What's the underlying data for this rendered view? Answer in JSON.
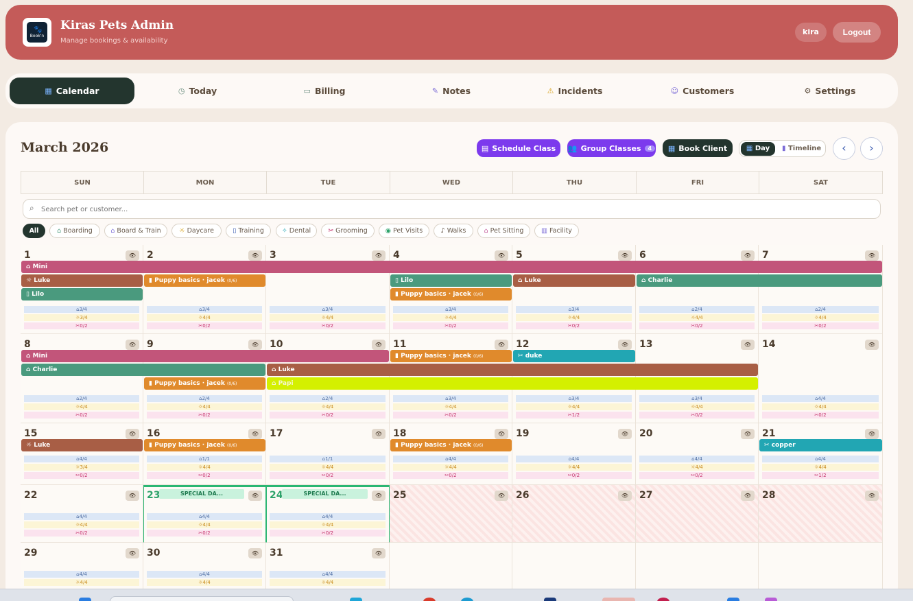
{
  "header": {
    "logo_text": "Book'n",
    "title": "Kiras Pets Admin",
    "subtitle": "Manage bookings & availability",
    "user": "kira",
    "logout": "Logout"
  },
  "nav": {
    "tabs": [
      {
        "label": "Calendar",
        "icon": "calendar-icon",
        "active": true
      },
      {
        "label": "Today",
        "icon": "clock-icon"
      },
      {
        "label": "Billing",
        "icon": "credit-card-icon"
      },
      {
        "label": "Notes",
        "icon": "edit-icon"
      },
      {
        "label": "Incidents",
        "icon": "warning-icon"
      },
      {
        "label": "Customers",
        "icon": "users-icon"
      },
      {
        "label": "Settings",
        "icon": "gear-icon"
      }
    ]
  },
  "calendar": {
    "month": "March 2026",
    "schedule_class": "Schedule Class",
    "group_classes": "Group Classes",
    "group_classes_count": "4",
    "book_client": "Book Client",
    "view_day": "Day",
    "view_timeline": "Timeline",
    "weekdays": [
      "SUN",
      "MON",
      "TUE",
      "WED",
      "THU",
      "FRI",
      "SAT"
    ],
    "search_placeholder": "Search pet or customer...",
    "filters": [
      {
        "label": "All",
        "icon": "",
        "active": true
      },
      {
        "label": "Boarding",
        "icon": "home-icon"
      },
      {
        "label": "Board & Train",
        "icon": "graduation-cap-icon"
      },
      {
        "label": "Daycare",
        "icon": "sun-icon"
      },
      {
        "label": "Training",
        "icon": "clipboard-icon"
      },
      {
        "label": "Dental",
        "icon": "sparkle-icon"
      },
      {
        "label": "Grooming",
        "icon": "scissors-icon"
      },
      {
        "label": "Pet Visits",
        "icon": "map-pin-icon"
      },
      {
        "label": "Walks",
        "icon": "footprints-icon"
      },
      {
        "label": "Pet Sitting",
        "icon": "house-heart-icon"
      },
      {
        "label": "Facility",
        "icon": "building-icon"
      }
    ],
    "special_day_label": "SPECIAL DA...",
    "colors": {
      "board_train": "#c2557a",
      "daycare": "#a85e45",
      "training": "#4a9a7e",
      "boarding": "#4a9a7e",
      "class": "#e08a2c",
      "grooming": "#22a6b3",
      "highlight": "#d4f000",
      "accent_purple": "#7c3aed",
      "dark": "#23352e",
      "header": "#c45b59"
    },
    "weeks": [
      {
        "days": [
          {
            "n": "1",
            "caps": [
              "3/4",
              "3/4",
              "0/2"
            ]
          },
          {
            "n": "2",
            "caps": [
              "3/4",
              "4/4",
              "0/2"
            ]
          },
          {
            "n": "3",
            "caps": [
              "3/4",
              "4/4",
              "0/2"
            ]
          },
          {
            "n": "4",
            "caps": [
              "3/4",
              "4/4",
              "0/2"
            ]
          },
          {
            "n": "5",
            "caps": [
              "3/4",
              "4/4",
              "0/2"
            ]
          },
          {
            "n": "6",
            "caps": [
              "2/4",
              "4/4",
              "0/2"
            ]
          },
          {
            "n": "7",
            "caps": [
              "2/4",
              "4/4",
              "0/2"
            ]
          }
        ],
        "events": [
          {
            "label": "Mini",
            "icon": "graduation-cap-icon"
          },
          {
            "label": "Luke",
            "icon": "sun-icon"
          },
          {
            "label": "Puppy basics · jacek",
            "sub": "(0/6)",
            "icon": "users-icon"
          },
          {
            "label": "Lilo",
            "icon": "clipboard-icon"
          },
          {
            "label": "Luke",
            "icon": "home-icon"
          },
          {
            "label": "Charlie",
            "icon": "home-icon"
          },
          {
            "label": "Lilo",
            "icon": "clipboard-icon"
          },
          {
            "label": "Puppy basics · jacek",
            "sub": "(0/6)",
            "icon": "users-icon"
          }
        ]
      },
      {
        "days": [
          {
            "n": "8",
            "caps": [
              "2/4",
              "4/4",
              "0/2"
            ]
          },
          {
            "n": "9",
            "caps": [
              "2/4",
              "4/4",
              "0/2"
            ]
          },
          {
            "n": "10",
            "caps": [
              "2/4",
              "4/4",
              "0/2"
            ]
          },
          {
            "n": "11",
            "caps": [
              "3/4",
              "4/4",
              "0/2"
            ]
          },
          {
            "n": "12",
            "caps": [
              "3/4",
              "4/4",
              "1/2"
            ]
          },
          {
            "n": "13",
            "caps": [
              "3/4",
              "4/4",
              "0/2"
            ]
          },
          {
            "n": "14",
            "caps": [
              "4/4",
              "4/4",
              "0/2"
            ]
          }
        ],
        "events": [
          {
            "label": "Mini",
            "icon": "graduation-cap-icon"
          },
          {
            "label": "Puppy basics · jacek",
            "sub": "(0/6)",
            "icon": "users-icon"
          },
          {
            "label": "duke",
            "icon": "scissors-icon"
          },
          {
            "label": "Charlie",
            "icon": "home-icon"
          },
          {
            "label": "Luke",
            "icon": "home-icon"
          },
          {
            "label": "Puppy basics · jacek",
            "sub": "(0/6)",
            "icon": "users-icon"
          },
          {
            "label": "Papi",
            "icon": "home-icon"
          }
        ]
      },
      {
        "days": [
          {
            "n": "15",
            "caps": [
              "4/4",
              "3/4",
              "0/2"
            ]
          },
          {
            "n": "16",
            "caps": [
              "1/1",
              "4/4",
              "0/2"
            ]
          },
          {
            "n": "17",
            "caps": [
              "1/1",
              "4/4",
              "0/2"
            ]
          },
          {
            "n": "18",
            "caps": [
              "4/4",
              "4/4",
              "0/2"
            ]
          },
          {
            "n": "19",
            "caps": [
              "4/4",
              "4/4",
              "0/2"
            ]
          },
          {
            "n": "20",
            "caps": [
              "4/4",
              "4/4",
              "0/2"
            ]
          },
          {
            "n": "21",
            "caps": [
              "4/4",
              "4/4",
              "1/2"
            ]
          }
        ],
        "events": [
          {
            "label": "Luke",
            "icon": "sun-icon"
          },
          {
            "label": "Puppy basics · jacek",
            "sub": "(0/6)",
            "icon": "users-icon"
          },
          {
            "label": "Puppy basics · jacek",
            "sub": "(0/6)",
            "icon": "users-icon"
          },
          {
            "label": "copper",
            "icon": "scissors-icon"
          }
        ]
      },
      {
        "days": [
          {
            "n": "22",
            "caps": [
              "4/4",
              "4/4",
              "0/2"
            ]
          },
          {
            "n": "23",
            "caps": [
              "4/4",
              "4/4",
              "0/2"
            ]
          },
          {
            "n": "24",
            "caps": [
              "4/4",
              "4/4",
              "0/2"
            ]
          },
          {
            "n": "25",
            "caps": []
          },
          {
            "n": "26",
            "caps": []
          },
          {
            "n": "27",
            "caps": []
          },
          {
            "n": "28",
            "caps": []
          }
        ],
        "events": []
      },
      {
        "days": [
          {
            "n": "29",
            "caps": [
              "4/4",
              "4/4"
            ]
          },
          {
            "n": "30",
            "caps": [
              "4/4",
              "4/4"
            ]
          },
          {
            "n": "31",
            "caps": [
              "4/4",
              "4/4"
            ]
          }
        ],
        "events": []
      }
    ]
  }
}
